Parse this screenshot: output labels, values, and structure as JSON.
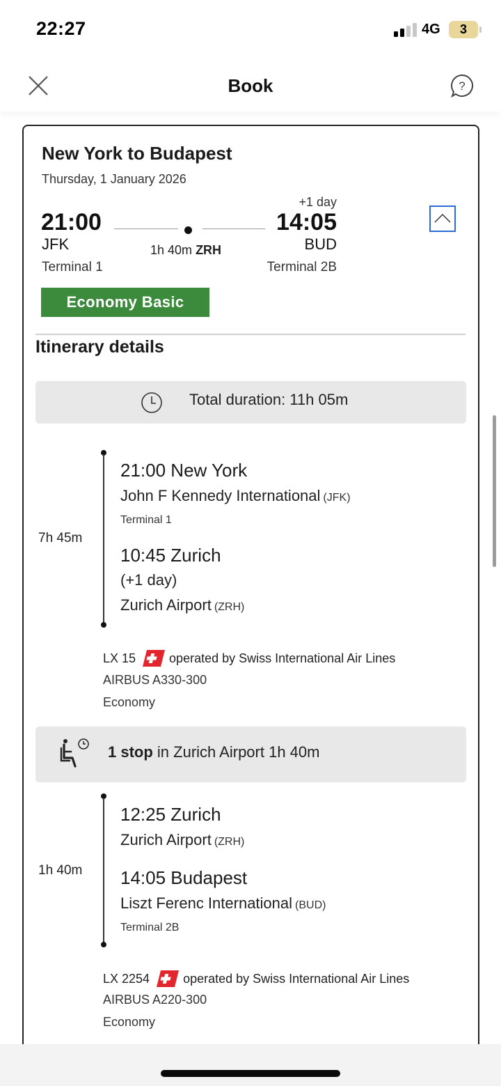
{
  "status_bar": {
    "time": "22:27",
    "network": "4G",
    "battery": "3"
  },
  "header": {
    "title": "Book",
    "close_icon": "close-icon",
    "help_icon": "help-icon"
  },
  "summary": {
    "route_title": "New York to Budapest",
    "date": "Thursday, 1 January 2026",
    "departure_time": "21:00",
    "departure_code": "JFK",
    "departure_terminal": "Terminal 1",
    "arrival_day_offset": "+1 day",
    "arrival_time": "14:05",
    "arrival_code": "BUD",
    "arrival_terminal": "Terminal 2B",
    "stop_duration": "1h 40m",
    "stop_code": "ZRH",
    "fare_class": "Economy Basic"
  },
  "itinerary": {
    "title": "Itinerary details",
    "total_duration": "Total duration: 11h 05m",
    "segments": [
      {
        "duration": "7h 45m",
        "depart_time_city": "21:00 New York",
        "depart_airport": "John F Kennedy International",
        "depart_airport_code": "(JFK)",
        "depart_terminal": "Terminal 1",
        "arrive_time_city": "10:45 Zurich",
        "arrive_day_offset": "(+1 day)",
        "arrive_airport": "Zurich Airport",
        "arrive_airport_code": "(ZRH)",
        "flight_number": "LX 15",
        "operated_by": "operated by Swiss International Air Lines",
        "aircraft": "AIRBUS A330-300",
        "cabin": "Economy"
      },
      {
        "duration": "1h 40m",
        "depart_time_city": "12:25 Zurich",
        "depart_airport": "Zurich Airport",
        "depart_airport_code": "(ZRH)",
        "arrive_time_city": "14:05 Budapest",
        "arrive_airport": "Liszt Ferenc International",
        "arrive_airport_code": "(BUD)",
        "arrive_terminal": "Terminal 2B",
        "flight_number": "LX 2254",
        "operated_by": "operated by Swiss International Air Lines",
        "aircraft": "AIRBUS A220-300",
        "cabin": "Economy"
      }
    ],
    "layover": {
      "stop_label": "1 stop",
      "detail": "in Zurich Airport 1h 40m"
    }
  },
  "colors": {
    "fare_badge": "#3c8a3c",
    "collapse_border": "#2c6bd6",
    "swiss_red": "#e3262d"
  }
}
